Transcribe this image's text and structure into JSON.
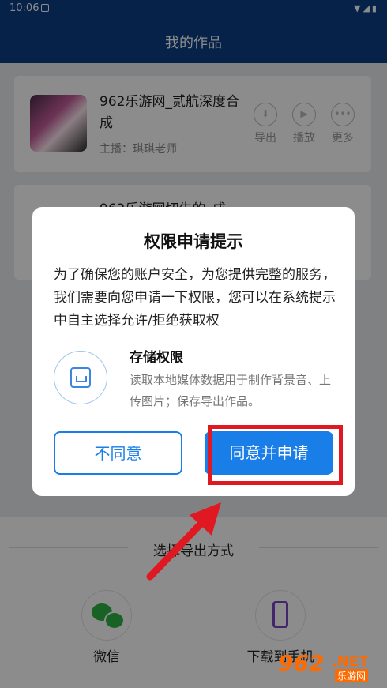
{
  "status_bar": {
    "time": "10:06",
    "system_icons": "wifi-icon signal-icon battery-icon"
  },
  "app_bar": {
    "title": "我的作品"
  },
  "works": [
    {
      "title": "962乐游网_贰航深度合成",
      "anchor": "主播：琪琪老师",
      "actions": [
        "导出",
        "播放",
        "更多"
      ]
    },
    {
      "title": "962乐游网切生的_成"
    }
  ],
  "export_panel": {
    "title": "选择导出方式",
    "options": [
      {
        "label": "微信",
        "icon": "wechat-icon"
      },
      {
        "label": "下载到手机",
        "icon": "phone-icon"
      }
    ]
  },
  "dialog": {
    "title": "权限申请提示",
    "text": "为了确保您的账户安全，为您提供完整的服务，我们需要向您申请一下权限，您可以在系统提示中自主选择允许/拒绝获取权",
    "permission": {
      "name": "存储权限",
      "description": "读取本地媒体数据用于制作背景音、上传图片；保存导出作品。",
      "icon": "save-disk-icon"
    },
    "deny_label": "不同意",
    "agree_label": "同意并申请"
  },
  "watermark": {
    "number": "962",
    "net": ".NET",
    "cn": "乐游网"
  },
  "colors": {
    "app_bar": "#0e3f86",
    "primary": "#1a7ee8",
    "highlight": "#e01822",
    "arrow": "#e01822"
  }
}
